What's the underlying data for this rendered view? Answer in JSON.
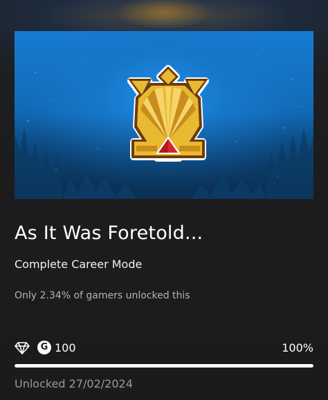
{
  "achievement": {
    "title": "As It Was Foretold...",
    "description": "Complete Career Mode",
    "rarity_text": "Only 2.34% of gamers unlocked this",
    "gamerscore": "100",
    "gamerscore_symbol": "G",
    "progress_text": "100%",
    "progress_value": 1.0,
    "unlocked_text": "Unlocked 27/02/2024"
  },
  "icons": {
    "rarity": "diamond-icon",
    "gamerscore": "gamerscore-icon",
    "badge": "achievement-badge-icon"
  },
  "colors": {
    "background": "#1b1b1c",
    "hero_blue": "#1677c9",
    "badge_gold": "#e8b931",
    "badge_red": "#d9252a",
    "progress_fill": "#ffffff",
    "progress_track": "#4a4a4a",
    "secondary_text": "#b4b4b4"
  }
}
